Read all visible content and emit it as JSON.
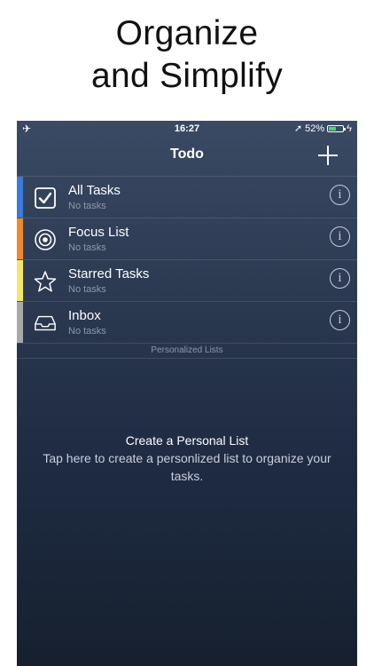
{
  "headline": {
    "line1": "Organize",
    "line2": "and Simplify"
  },
  "status_bar": {
    "time": "16:27",
    "battery_text": "52%",
    "battery_level": 0.52
  },
  "nav": {
    "title": "Todo"
  },
  "lists": [
    {
      "name": "All Tasks",
      "subtitle": "No tasks",
      "color": "#3a7bdc",
      "icon": "checkbox-icon"
    },
    {
      "name": "Focus List",
      "subtitle": "No tasks",
      "color": "#f0892b",
      "icon": "target-icon"
    },
    {
      "name": "Starred Tasks",
      "subtitle": "No tasks",
      "color": "#f4e76a",
      "icon": "star-icon"
    },
    {
      "name": "Inbox",
      "subtitle": "No tasks",
      "color": "#a9a9a9",
      "icon": "inbox-tray-icon"
    }
  ],
  "info_glyph": "i",
  "section": {
    "label": "Personalized Lists"
  },
  "empty_state": {
    "title": "Create a Personal List",
    "body": "Tap here to create a personlized list to organize your tasks."
  }
}
